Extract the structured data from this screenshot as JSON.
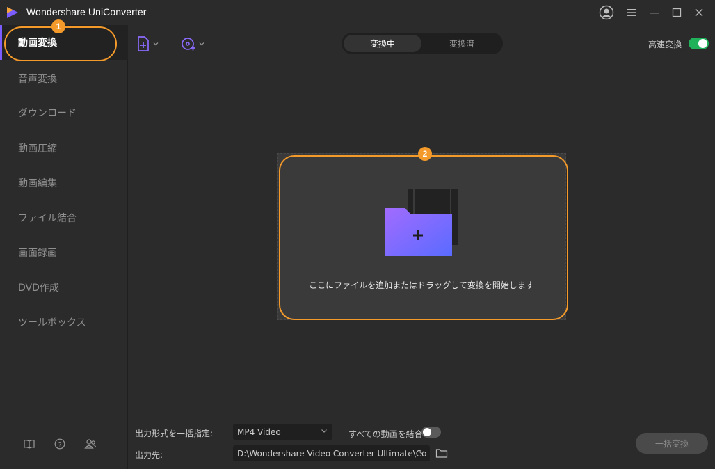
{
  "app": {
    "title": "Wondershare UniConverter"
  },
  "sidebar": {
    "items": [
      {
        "label": "動画変換",
        "active": true
      },
      {
        "label": "音声変換"
      },
      {
        "label": "ダウンロード"
      },
      {
        "label": "動画圧縮"
      },
      {
        "label": "動画編集"
      },
      {
        "label": "ファイル結合"
      },
      {
        "label": "画面録画"
      },
      {
        "label": "DVD作成"
      },
      {
        "label": "ツールボックス"
      }
    ],
    "bottom_icons": [
      "book-icon",
      "help-icon",
      "users-icon"
    ]
  },
  "annotations": {
    "badge1": "1",
    "badge2": "2"
  },
  "toolbar": {
    "tabs": [
      "変換中",
      "変換済"
    ],
    "fast_convert_label": "高速変換",
    "fast_convert_on": true
  },
  "dropzone": {
    "text": "ここにファイルを追加またはドラッグして変換を開始します"
  },
  "bottom": {
    "format_label": "出力形式を一括指定:",
    "format_value": "MP4 Video",
    "merge_label": "すべての動画を結合",
    "merge_on": false,
    "output_label": "出力先:",
    "output_path": "D:\\Wondershare Video Converter Ultimate\\Co",
    "convert_all_label": "一括変換"
  },
  "colors": {
    "accent": "#7b5cff",
    "highlight": "#f39a2b",
    "toggle_on": "#1fb25a",
    "folder_start": "#9b6cff",
    "folder_end": "#5a6bff"
  }
}
